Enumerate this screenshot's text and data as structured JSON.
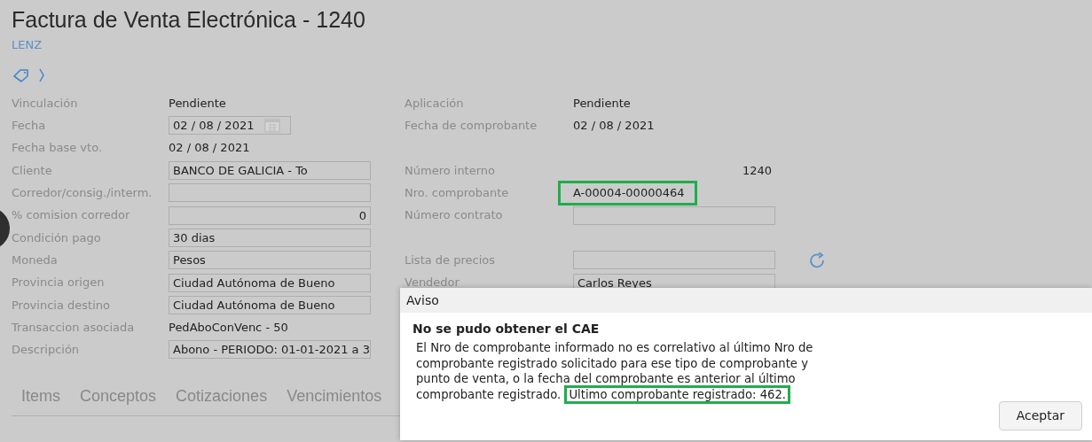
{
  "header": {
    "title": "Factura de Venta Electrónica - 1240",
    "subtitle": "LENZ"
  },
  "rows": [
    {
      "left": {
        "label": "Vinculación",
        "value": "Pendiente",
        "kind": "text"
      },
      "right": {
        "label": "Aplicación",
        "value": "Pendiente",
        "kind": "text"
      }
    },
    {
      "left": {
        "label": "Fecha",
        "value": "02 / 08 / 2021",
        "kind": "date"
      },
      "right": {
        "label": "Fecha de comprobante",
        "value": "02 / 08 / 2021",
        "kind": "text"
      }
    },
    {
      "left": {
        "label": "Fecha base vto.",
        "value": "02 / 08 / 2021",
        "kind": "text"
      }
    },
    {
      "left": {
        "label": "Cliente",
        "value": "BANCO DE GALICIA - To",
        "kind": "input"
      },
      "right": {
        "label": "Número interno",
        "value": "1240",
        "kind": "number"
      }
    },
    {
      "left": {
        "label": "Corredor/consig./interm.",
        "kind": "input"
      },
      "right": {
        "label": "Nro. comprobante",
        "value": "A-00004-00000464",
        "kind": "text",
        "highlighted": true
      }
    },
    {
      "left": {
        "label": "% comision corredor",
        "value": "0",
        "kind": "number_input"
      },
      "right": {
        "label": "Número contrato",
        "kind": "input"
      }
    },
    {
      "left": {
        "label": "Condición pago",
        "value": "30 dias",
        "kind": "input"
      }
    },
    {
      "left": {
        "label": "Moneda",
        "value": "Pesos",
        "kind": "input"
      },
      "right": {
        "label": "Lista de precios",
        "kind": "input_refresh"
      }
    },
    {
      "left": {
        "label": "Provincia origen",
        "value": "Ciudad Autónoma de Bueno",
        "kind": "input"
      },
      "right": {
        "label": "Vendedor",
        "value": "Carlos Reyes",
        "kind": "input"
      }
    },
    {
      "left": {
        "label": "Provincia destino",
        "value": "Ciudad Autónoma de Bueno",
        "kind": "input"
      }
    },
    {
      "left": {
        "label": "Transaccion asociada",
        "value": "PedAboConVenc - 50",
        "kind": "text"
      }
    },
    {
      "left": {
        "label": "Descripción",
        "value": "Abono - PERIODO: 01-01-2021 a 3",
        "kind": "input"
      }
    }
  ],
  "tabs": [
    {
      "label": "Items",
      "selected": false
    },
    {
      "label": "Conceptos",
      "selected": false
    },
    {
      "label": "Cotizaciones",
      "selected": false
    },
    {
      "label": "Vencimientos",
      "selected": false
    }
  ],
  "dialog": {
    "title": "Aviso",
    "heading": "No se pudo obtener el CAE",
    "message": "El Nro de comprobante informado no es correlativo al último Nro de comprobante registrado solicitado para ese tipo de comprobante y punto de venta, o la fecha del comprobante es anterior al último comprobante registrado.",
    "highlight": "Ultimo comprobante registrado: 462.",
    "button": "Aceptar"
  }
}
